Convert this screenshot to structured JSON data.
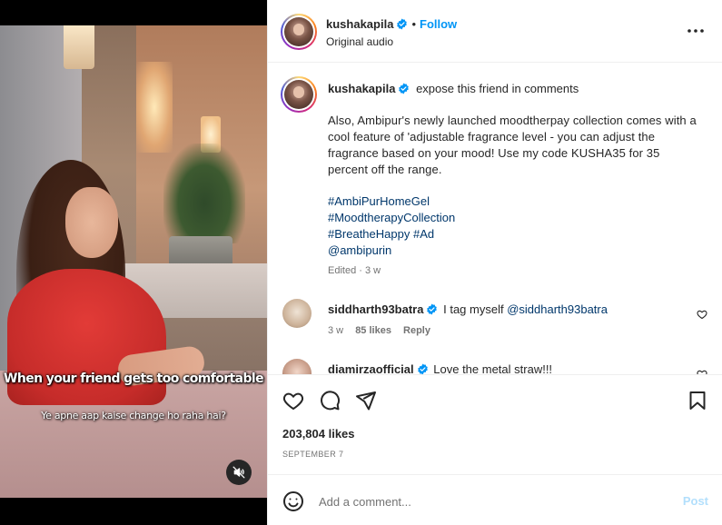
{
  "video": {
    "caption_main": "When your friend gets too comfortable",
    "caption_sub": "Ye apne aap kaise change ho raha hai?",
    "mute_icon": "speaker-muted-icon"
  },
  "header": {
    "username": "kushakapila",
    "follow_label": "Follow",
    "separator": "•",
    "audio_label": "Original audio",
    "more_icon": "more-options-icon"
  },
  "post": {
    "username": "kushakapila",
    "headline": "expose this friend in comments",
    "body": "Also, Ambipur's newly launched moodtherpay collection comes with a cool feature of 'adjustable fragrance level - you can adjust the fragrance based on your mood! Use my code KUSHA35 for 35 percent off the range.",
    "hashtags": [
      "#AmbiPurHomeGel",
      "#MoodtherapyCollection"
    ],
    "hashtag_line3a": "#BreatheHappy",
    "hashtag_line3b": "#Ad",
    "mention": "@ambipurin",
    "edited": "Edited · 3 w"
  },
  "comments": [
    {
      "username": "siddharth93batra",
      "text": "I tag myself",
      "mention": "@siddharth93batra",
      "time": "3 w",
      "likes": "85 likes",
      "reply": "Reply"
    },
    {
      "username": "diamirzaofficial",
      "text": "Love the metal straw!!!"
    }
  ],
  "actions": {
    "likes": "203,804 likes",
    "date": "SEPTEMBER 7"
  },
  "comment_bar": {
    "placeholder": "Add a comment...",
    "post_label": "Post"
  },
  "colors": {
    "accent": "#0095f6",
    "link": "#00376b",
    "muted": "#737373",
    "post_disabled": "#b2dffc"
  }
}
